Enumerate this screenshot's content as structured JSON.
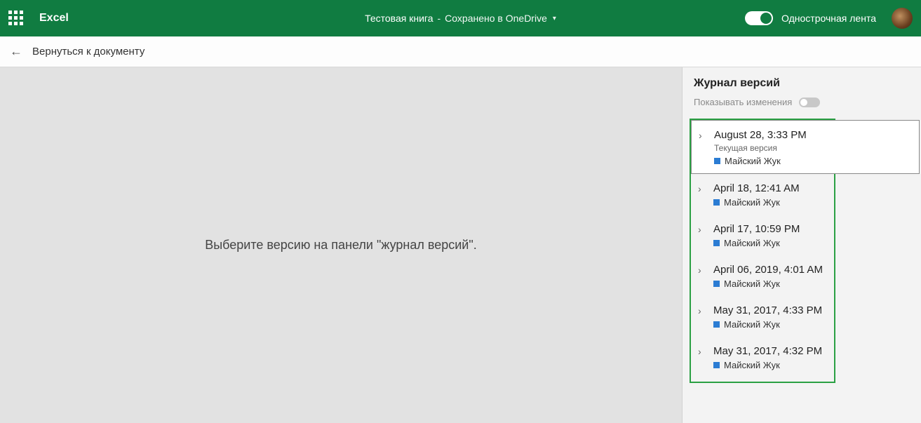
{
  "header": {
    "app_name": "Excel",
    "doc_title": "Тестовая книга",
    "separator": "-",
    "doc_status": "Сохранено в OneDrive",
    "ribbon_label": "Однострочная лента"
  },
  "subbar": {
    "back_label": "Вернуться к документу"
  },
  "main": {
    "prompt": "Выберите версию на панели \"журнал версий\"."
  },
  "sidebar": {
    "title": "Журнал версий",
    "show_changes_label": "Показывать изменения",
    "versions": [
      {
        "date": "August 28, 3:33 PM",
        "sublabel": "Текущая версия",
        "author": "Майский Жук",
        "selected": true
      },
      {
        "date": "April 18, 12:41 AM",
        "author": "Майский Жук"
      },
      {
        "date": "April 17, 10:59 PM",
        "author": "Майский Жук"
      },
      {
        "date": "April 06, 2019, 4:01 AM",
        "author": "Майский Жук"
      },
      {
        "date": "May 31, 2017, 4:33 PM",
        "author": "Майский Жук"
      },
      {
        "date": "May 31, 2017, 4:32 PM",
        "author": "Майский Жук"
      }
    ]
  }
}
